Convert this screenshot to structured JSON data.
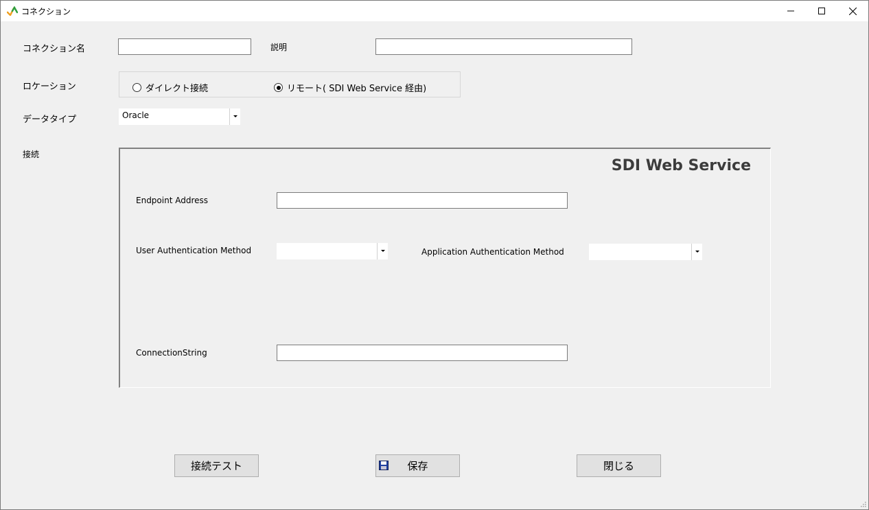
{
  "window": {
    "title": "コネクション"
  },
  "form": {
    "connection_name_label": "コネクション名",
    "connection_name_value": "",
    "description_label": "説明",
    "description_value": "",
    "location_label": "ロケーション",
    "location_options": [
      {
        "label": "ダイレクト接続",
        "checked": false
      },
      {
        "label": "リモート( SDI Web Service 経由)",
        "checked": true
      }
    ],
    "datatype_label": "データタイプ",
    "datatype_value": "Oracle",
    "connection_label": "接続"
  },
  "panel": {
    "title": "SDI Web Service",
    "endpoint_label": "Endpoint Address",
    "endpoint_value": "",
    "user_auth_label": "User Authentication Method",
    "user_auth_value": "",
    "app_auth_label": "Application Authentication Method",
    "app_auth_value": "",
    "connstring_label": "ConnectionString",
    "connstring_value": ""
  },
  "buttons": {
    "test": "接続テスト",
    "save": "保存",
    "close": "閉じる"
  },
  "colors": {
    "accent_green": "#2e9e3e",
    "accent_orange": "#f0a020",
    "save_icon_blue": "#2040a0"
  }
}
